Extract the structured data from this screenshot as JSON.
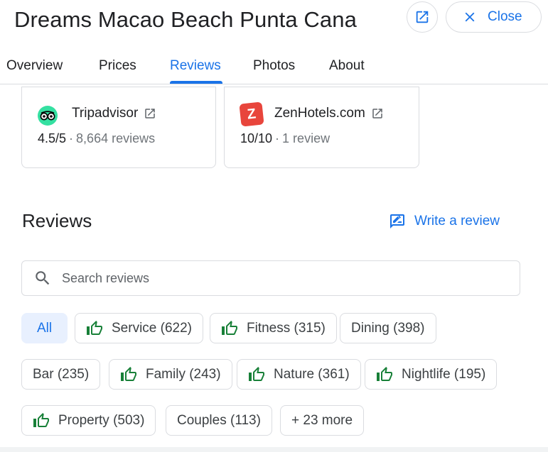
{
  "header": {
    "title": "Dreams Macao Beach Punta Cana",
    "close_label": "Close"
  },
  "tabs": [
    {
      "label": "Overview"
    },
    {
      "label": "Prices"
    },
    {
      "label": "Reviews"
    },
    {
      "label": "Photos"
    },
    {
      "label": "About"
    }
  ],
  "sources": [
    {
      "name": "Tripadvisor",
      "score": "4.5/5",
      "sep": "·",
      "count": "8,664 reviews"
    },
    {
      "name": "ZenHotels.com",
      "logo_letter": "Z",
      "score": "10/10",
      "sep": "·",
      "count": "1 review"
    }
  ],
  "reviews": {
    "title": "Reviews",
    "write_label": "Write a review",
    "search_placeholder": "Search reviews"
  },
  "chips": [
    {
      "label": "All"
    },
    {
      "label": "Service (622)"
    },
    {
      "label": "Fitness (315)"
    },
    {
      "label": "Dining (398)"
    },
    {
      "label": "Bar (235)"
    },
    {
      "label": "Family (243)"
    },
    {
      "label": "Nature (361)"
    },
    {
      "label": "Nightlife (195)"
    },
    {
      "label": "Property (503)"
    },
    {
      "label": "Couples (113)"
    },
    {
      "label": "+ 23 more"
    }
  ],
  "colors": {
    "accent": "#1a73e8",
    "positive": "#188038",
    "tripadvisor": "#34e0a1",
    "zenhotels": "#e8453c"
  }
}
